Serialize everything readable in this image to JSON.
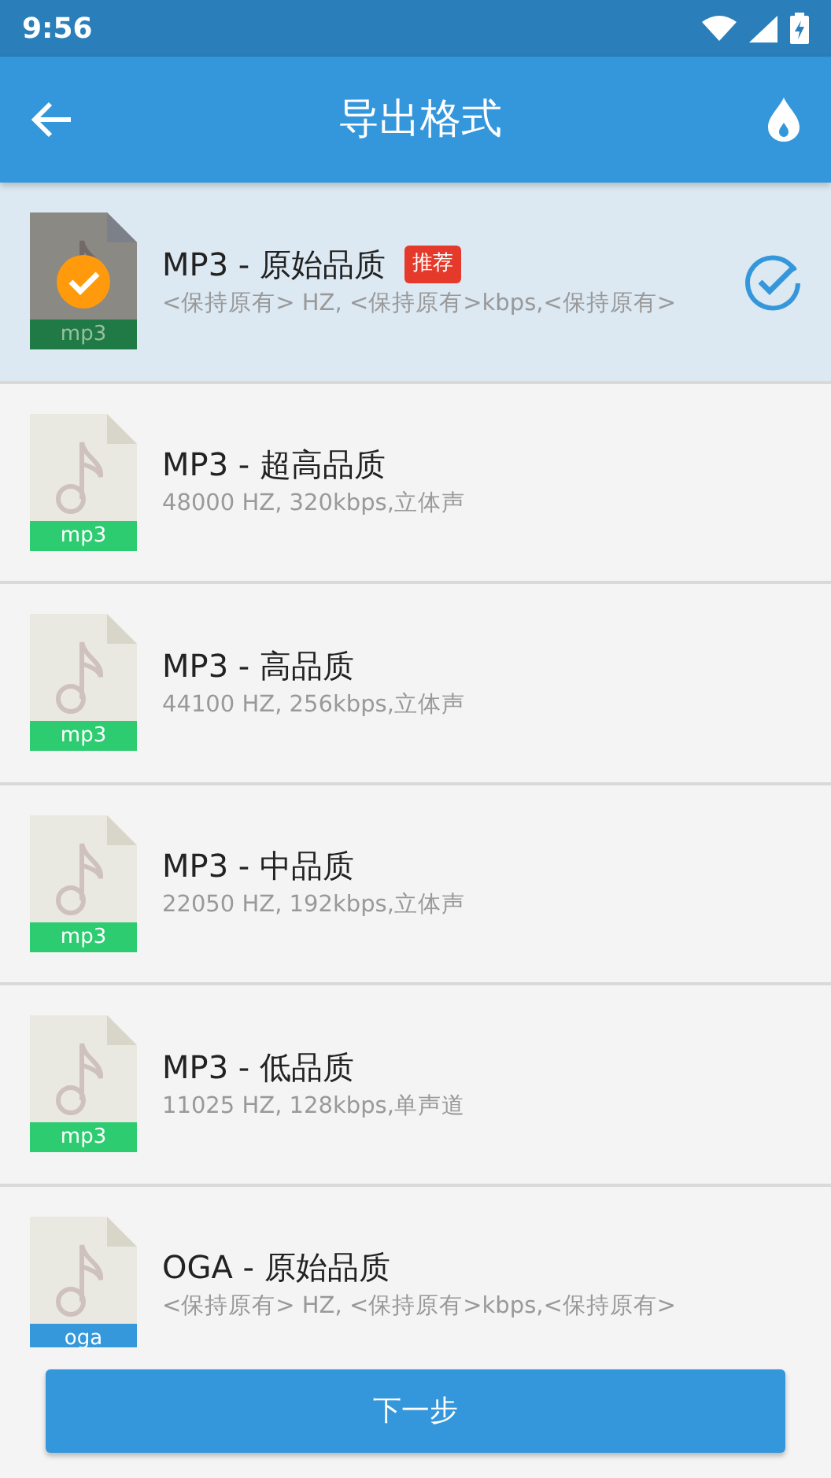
{
  "status_bar": {
    "time": "9:56"
  },
  "app_bar": {
    "title": "导出格式"
  },
  "formats": [
    {
      "ext": "mp3",
      "color": "#1f7a46",
      "title": "MP3 - 原始品质",
      "badge": "推荐",
      "details": "<保持原有> HZ, <保持原有>kbps,<保持原有>",
      "selected": true
    },
    {
      "ext": "mp3",
      "color": "#2ecc71",
      "title": "MP3 - 超高品质",
      "details": "48000 HZ, 320kbps,立体声",
      "selected": false
    },
    {
      "ext": "mp3",
      "color": "#2ecc71",
      "title": "MP3 - 高品质",
      "details": "44100 HZ, 256kbps,立体声",
      "selected": false
    },
    {
      "ext": "mp3",
      "color": "#2ecc71",
      "title": "MP3 - 中品质",
      "details": "22050 HZ, 192kbps,立体声",
      "selected": false
    },
    {
      "ext": "mp3",
      "color": "#2ecc71",
      "title": "MP3 - 低品质",
      "details": "11025 HZ, 128kbps,单声道",
      "selected": false
    },
    {
      "ext": "oga",
      "color": "#3498db",
      "title": "OGA - 原始品质",
      "details": "<保持原有> HZ, <保持原有>kbps,<保持原有>",
      "selected": false
    }
  ],
  "next_button": "下一步"
}
